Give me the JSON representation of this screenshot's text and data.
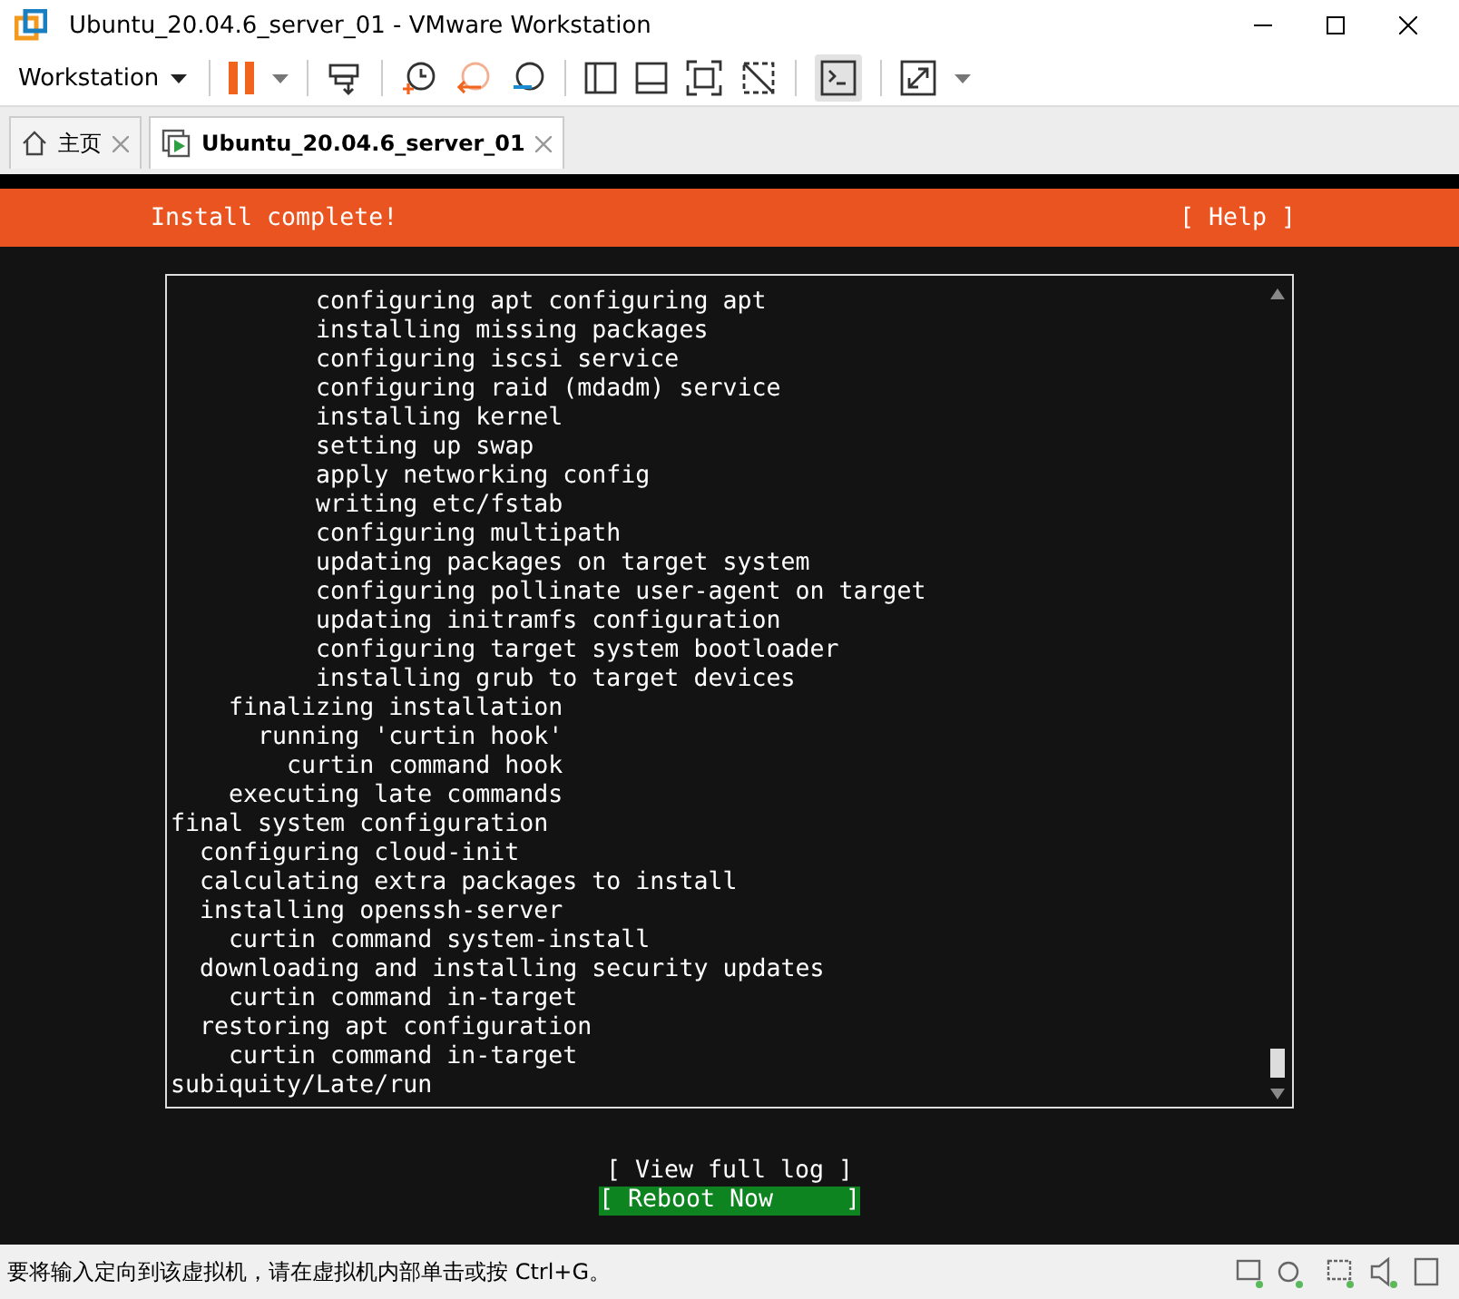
{
  "window": {
    "title": "Ubuntu_20.04.6_server_01 - VMware Workstation"
  },
  "toolbar": {
    "menu": "Workstation"
  },
  "tabs": [
    {
      "label": "主页",
      "kind": "home",
      "selected": false
    },
    {
      "label": "Ubuntu_20.04.6_server_01",
      "kind": "vm",
      "selected": true
    }
  ],
  "installer": {
    "title": "Install complete!",
    "help": "[ Help ]",
    "log": [
      "          configuring apt configuring apt",
      "          installing missing packages",
      "          configuring iscsi service",
      "          configuring raid (mdadm) service",
      "          installing kernel",
      "          setting up swap",
      "          apply networking config",
      "          writing etc/fstab",
      "          configuring multipath",
      "          updating packages on target system",
      "          configuring pollinate user-agent on target",
      "          updating initramfs configuration",
      "          configuring target system bootloader",
      "          installing grub to target devices",
      "    finalizing installation",
      "      running 'curtin hook'",
      "        curtin command hook",
      "    executing late commands",
      "final system configuration",
      "  configuring cloud-init",
      "  calculating extra packages to install",
      "  installing openssh-server",
      "    curtin command system-install",
      "  downloading and installing security updates",
      "    curtin command in-target",
      "  restoring apt configuration",
      "    curtin command in-target",
      "subiquity/Late/run"
    ],
    "buttons": [
      {
        "label": "[ View full log ]",
        "selected": false
      },
      {
        "label": "[ Reboot Now     ]",
        "selected": true
      }
    ]
  },
  "status_bar": {
    "text": "要将输入定向到该虚拟机，请在虚拟机内部单击或按 Ctrl+G。"
  }
}
